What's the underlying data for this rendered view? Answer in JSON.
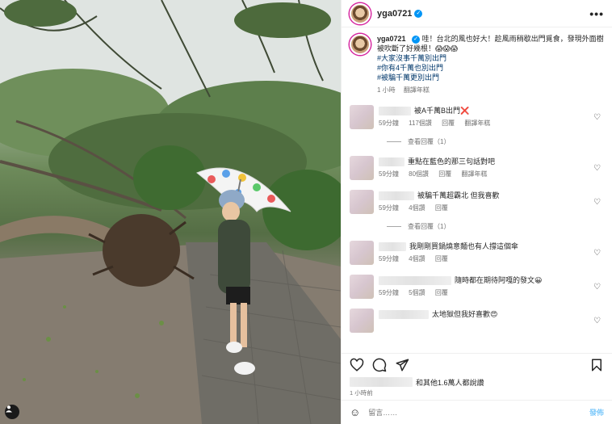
{
  "post": {
    "username": "yga0721",
    "more_label": "•••",
    "verified_glyph": "✓"
  },
  "caption": {
    "username": "yga0721",
    "text": "哇！台北的風也好大！趁風雨稍歇出門覓食，發現外面樹被吹斷了好幾根！😱😱😱",
    "tags": [
      "#大家沒事千萬別出門",
      "#你有4千萬也別出門",
      "#被騙千萬更別出門"
    ],
    "time": "1 小時",
    "translate": "翻譯年糕"
  },
  "comments": [
    {
      "text": "被A千萬B出門❌",
      "time": "59分鐘",
      "likes": "117個讚",
      "reply": "回覆",
      "translate": "翻譯年糕"
    },
    {
      "text": "重點在藍色的那三句話對吧",
      "time": "59分鐘",
      "likes": "80個讚",
      "reply": "回覆",
      "translate": "翻譯年糕"
    },
    {
      "text": "被騙千萬超霸北 但我喜歡",
      "time": "59分鐘",
      "likes": "4個讚",
      "reply": "回覆",
      "translate": ""
    },
    {
      "text": "我剛剛買鍋燒意麵也有人撐這個傘",
      "time": "59分鐘",
      "likes": "4個讚",
      "reply": "回覆",
      "translate": ""
    },
    {
      "text": "隨時都在期待阿嘎的發文😀",
      "time": "59分鐘",
      "likes": "5個讚",
      "reply": "回覆",
      "translate": ""
    },
    {
      "text": "太地獄但我好喜歡😍",
      "time": "",
      "likes": "",
      "reply": "",
      "translate": ""
    }
  ],
  "view_replies": [
    "查看回覆（1）",
    "查看回覆（1）"
  ],
  "likes_text": "和其他1.6萬人都說讚",
  "post_time": "1 小時前",
  "add_comment": {
    "placeholder": "留言……",
    "post_label": "發佈"
  },
  "icons": [
    "more-icon",
    "heart-icon",
    "comment-icon",
    "share-icon",
    "save-icon",
    "emoji-icon",
    "user-tag-icon"
  ],
  "colors": {
    "link": "#00376b",
    "accent": "#0095f6",
    "ring": "#d6249f"
  }
}
